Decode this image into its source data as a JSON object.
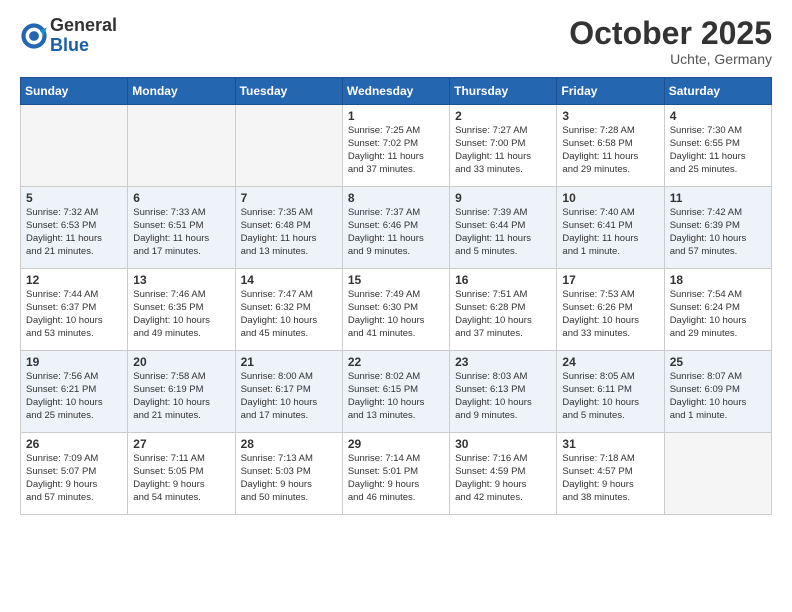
{
  "header": {
    "logo_general": "General",
    "logo_blue": "Blue",
    "month": "October 2025",
    "location": "Uchte, Germany"
  },
  "weekdays": [
    "Sunday",
    "Monday",
    "Tuesday",
    "Wednesday",
    "Thursday",
    "Friday",
    "Saturday"
  ],
  "weeks": [
    [
      {
        "day": "",
        "detail": ""
      },
      {
        "day": "",
        "detail": ""
      },
      {
        "day": "",
        "detail": ""
      },
      {
        "day": "1",
        "detail": "Sunrise: 7:25 AM\nSunset: 7:02 PM\nDaylight: 11 hours\nand 37 minutes."
      },
      {
        "day": "2",
        "detail": "Sunrise: 7:27 AM\nSunset: 7:00 PM\nDaylight: 11 hours\nand 33 minutes."
      },
      {
        "day": "3",
        "detail": "Sunrise: 7:28 AM\nSunset: 6:58 PM\nDaylight: 11 hours\nand 29 minutes."
      },
      {
        "day": "4",
        "detail": "Sunrise: 7:30 AM\nSunset: 6:55 PM\nDaylight: 11 hours\nand 25 minutes."
      }
    ],
    [
      {
        "day": "5",
        "detail": "Sunrise: 7:32 AM\nSunset: 6:53 PM\nDaylight: 11 hours\nand 21 minutes."
      },
      {
        "day": "6",
        "detail": "Sunrise: 7:33 AM\nSunset: 6:51 PM\nDaylight: 11 hours\nand 17 minutes."
      },
      {
        "day": "7",
        "detail": "Sunrise: 7:35 AM\nSunset: 6:48 PM\nDaylight: 11 hours\nand 13 minutes."
      },
      {
        "day": "8",
        "detail": "Sunrise: 7:37 AM\nSunset: 6:46 PM\nDaylight: 11 hours\nand 9 minutes."
      },
      {
        "day": "9",
        "detail": "Sunrise: 7:39 AM\nSunset: 6:44 PM\nDaylight: 11 hours\nand 5 minutes."
      },
      {
        "day": "10",
        "detail": "Sunrise: 7:40 AM\nSunset: 6:41 PM\nDaylight: 11 hours\nand 1 minute."
      },
      {
        "day": "11",
        "detail": "Sunrise: 7:42 AM\nSunset: 6:39 PM\nDaylight: 10 hours\nand 57 minutes."
      }
    ],
    [
      {
        "day": "12",
        "detail": "Sunrise: 7:44 AM\nSunset: 6:37 PM\nDaylight: 10 hours\nand 53 minutes."
      },
      {
        "day": "13",
        "detail": "Sunrise: 7:46 AM\nSunset: 6:35 PM\nDaylight: 10 hours\nand 49 minutes."
      },
      {
        "day": "14",
        "detail": "Sunrise: 7:47 AM\nSunset: 6:32 PM\nDaylight: 10 hours\nand 45 minutes."
      },
      {
        "day": "15",
        "detail": "Sunrise: 7:49 AM\nSunset: 6:30 PM\nDaylight: 10 hours\nand 41 minutes."
      },
      {
        "day": "16",
        "detail": "Sunrise: 7:51 AM\nSunset: 6:28 PM\nDaylight: 10 hours\nand 37 minutes."
      },
      {
        "day": "17",
        "detail": "Sunrise: 7:53 AM\nSunset: 6:26 PM\nDaylight: 10 hours\nand 33 minutes."
      },
      {
        "day": "18",
        "detail": "Sunrise: 7:54 AM\nSunset: 6:24 PM\nDaylight: 10 hours\nand 29 minutes."
      }
    ],
    [
      {
        "day": "19",
        "detail": "Sunrise: 7:56 AM\nSunset: 6:21 PM\nDaylight: 10 hours\nand 25 minutes."
      },
      {
        "day": "20",
        "detail": "Sunrise: 7:58 AM\nSunset: 6:19 PM\nDaylight: 10 hours\nand 21 minutes."
      },
      {
        "day": "21",
        "detail": "Sunrise: 8:00 AM\nSunset: 6:17 PM\nDaylight: 10 hours\nand 17 minutes."
      },
      {
        "day": "22",
        "detail": "Sunrise: 8:02 AM\nSunset: 6:15 PM\nDaylight: 10 hours\nand 13 minutes."
      },
      {
        "day": "23",
        "detail": "Sunrise: 8:03 AM\nSunset: 6:13 PM\nDaylight: 10 hours\nand 9 minutes."
      },
      {
        "day": "24",
        "detail": "Sunrise: 8:05 AM\nSunset: 6:11 PM\nDaylight: 10 hours\nand 5 minutes."
      },
      {
        "day": "25",
        "detail": "Sunrise: 8:07 AM\nSunset: 6:09 PM\nDaylight: 10 hours\nand 1 minute."
      }
    ],
    [
      {
        "day": "26",
        "detail": "Sunrise: 7:09 AM\nSunset: 5:07 PM\nDaylight: 9 hours\nand 57 minutes."
      },
      {
        "day": "27",
        "detail": "Sunrise: 7:11 AM\nSunset: 5:05 PM\nDaylight: 9 hours\nand 54 minutes."
      },
      {
        "day": "28",
        "detail": "Sunrise: 7:13 AM\nSunset: 5:03 PM\nDaylight: 9 hours\nand 50 minutes."
      },
      {
        "day": "29",
        "detail": "Sunrise: 7:14 AM\nSunset: 5:01 PM\nDaylight: 9 hours\nand 46 minutes."
      },
      {
        "day": "30",
        "detail": "Sunrise: 7:16 AM\nSunset: 4:59 PM\nDaylight: 9 hours\nand 42 minutes."
      },
      {
        "day": "31",
        "detail": "Sunrise: 7:18 AM\nSunset: 4:57 PM\nDaylight: 9 hours\nand 38 minutes."
      },
      {
        "day": "",
        "detail": ""
      }
    ]
  ]
}
